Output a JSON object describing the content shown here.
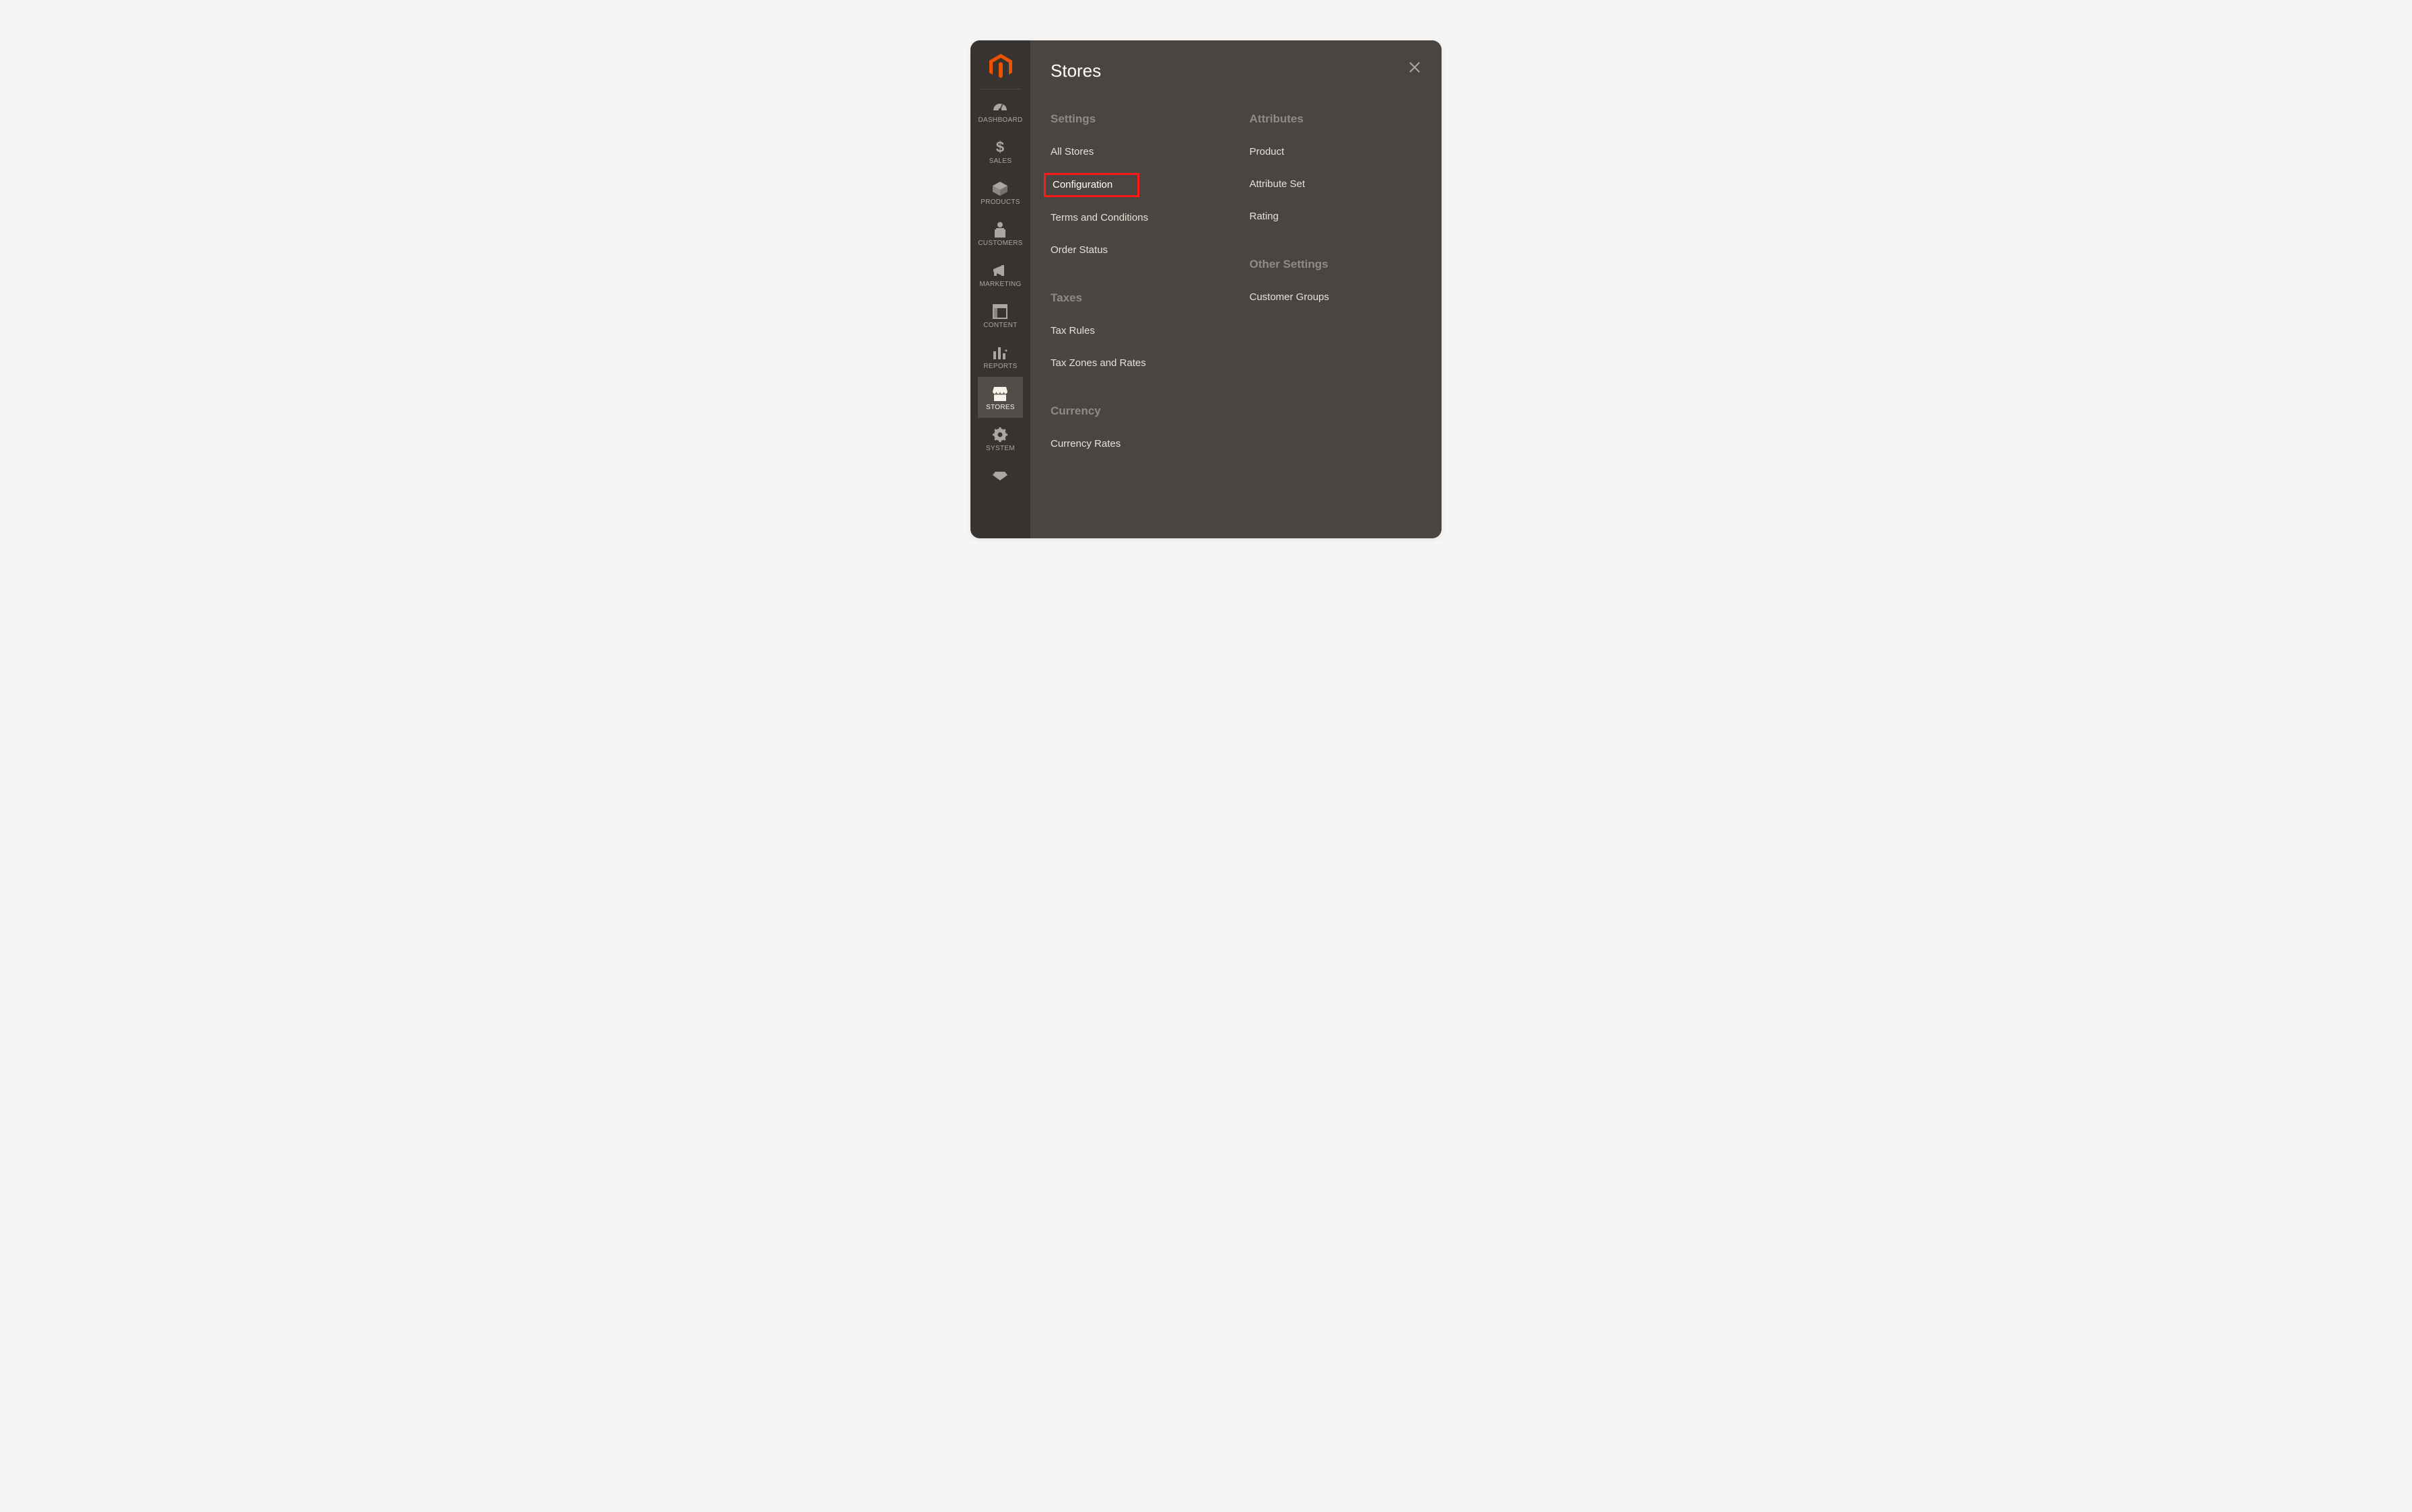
{
  "sidebar": {
    "items": [
      {
        "id": "dashboard",
        "label": "DASHBOARD",
        "icon": "dashboard-icon"
      },
      {
        "id": "sales",
        "label": "SALES",
        "icon": "dollar-icon"
      },
      {
        "id": "products",
        "label": "PRODUCTS",
        "icon": "box-icon"
      },
      {
        "id": "customers",
        "label": "CUSTOMERS",
        "icon": "person-icon"
      },
      {
        "id": "marketing",
        "label": "MARKETING",
        "icon": "megaphone-icon"
      },
      {
        "id": "content",
        "label": "CONTENT",
        "icon": "layout-icon"
      },
      {
        "id": "reports",
        "label": "REPORTS",
        "icon": "bar-chart-icon"
      },
      {
        "id": "stores",
        "label": "STORES",
        "icon": "storefront-icon",
        "active": true
      },
      {
        "id": "system",
        "label": "SYSTEM",
        "icon": "gear-icon"
      },
      {
        "id": "partners",
        "label": "",
        "icon": "diamond-icon",
        "partial": true
      }
    ]
  },
  "flyout": {
    "title": "Stores",
    "left": [
      {
        "heading": "Settings",
        "links": [
          {
            "text": "All Stores"
          },
          {
            "text": "Configuration",
            "highlight": true
          },
          {
            "text": "Terms and Conditions"
          },
          {
            "text": "Order Status"
          }
        ]
      },
      {
        "heading": "Taxes",
        "links": [
          {
            "text": "Tax Rules"
          },
          {
            "text": "Tax Zones and Rates"
          }
        ]
      },
      {
        "heading": "Currency",
        "links": [
          {
            "text": "Currency Rates"
          }
        ]
      }
    ],
    "right": [
      {
        "heading": "Attributes",
        "links": [
          {
            "text": "Product"
          },
          {
            "text": "Attribute Set"
          },
          {
            "text": "Rating"
          }
        ]
      },
      {
        "heading": "Other Settings",
        "links": [
          {
            "text": "Customer Groups"
          }
        ]
      }
    ]
  }
}
